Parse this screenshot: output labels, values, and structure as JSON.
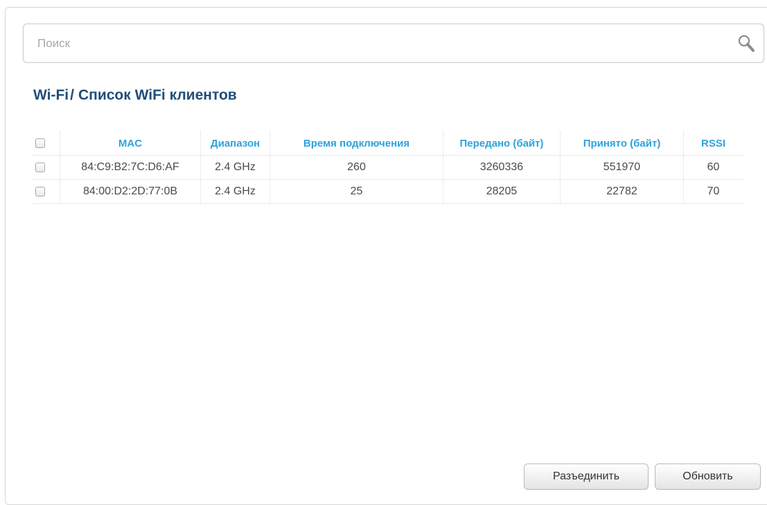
{
  "search": {
    "placeholder": "Поиск",
    "value": ""
  },
  "breadcrumb": {
    "parent": "Wi-Fi",
    "separator": "/",
    "current": "Список WiFi клиентов"
  },
  "table": {
    "columns": {
      "mac": "MAC",
      "band": "Диапазон",
      "connect_time": "Время подключения",
      "sent": "Передано (байт)",
      "received": "Принято (байт)",
      "rssi": "RSSI"
    },
    "rows": [
      {
        "mac": "84:C9:B2:7C:D6:AF",
        "band": "2.4 GHz",
        "connect_time": "260",
        "sent": "3260336",
        "received": "551970",
        "rssi": "60",
        "checked": false
      },
      {
        "mac": "84:00:D2:2D:77:0B",
        "band": "2.4 GHz",
        "connect_time": "25",
        "sent": "28205",
        "received": "22782",
        "rssi": "70",
        "checked": false
      }
    ]
  },
  "buttons": {
    "disconnect": "Разъединить",
    "refresh": "Обновить"
  },
  "colors": {
    "title": "#1f4e79",
    "header_text": "#2ea3dc",
    "border": "#d6d6d6"
  },
  "icons": {
    "search": "search-icon"
  }
}
